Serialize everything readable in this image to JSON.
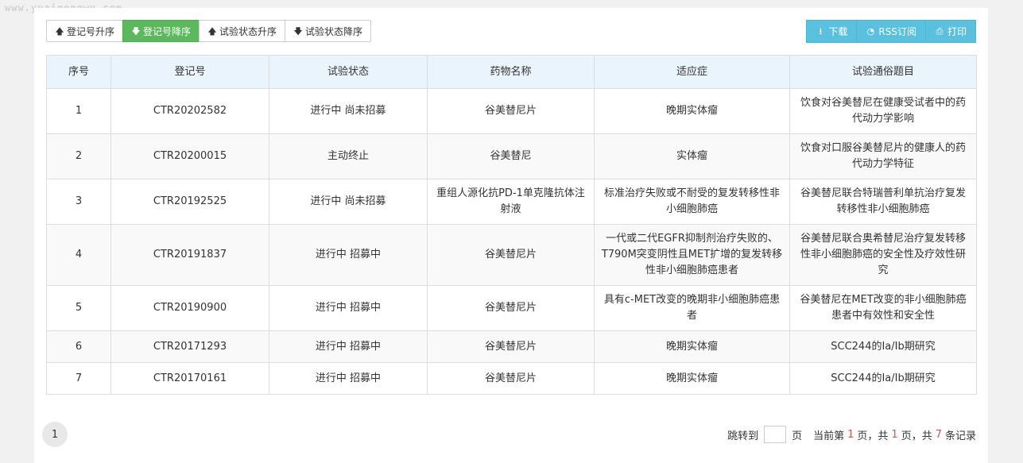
{
  "watermark": "www.yuaigongwu.com",
  "sort_buttons": [
    {
      "label": "登记号升序",
      "direction": "up",
      "active": false
    },
    {
      "label": "登记号降序",
      "direction": "down",
      "active": true
    },
    {
      "label": "试验状态升序",
      "direction": "up",
      "active": false
    },
    {
      "label": "试验状态降序",
      "direction": "down",
      "active": false
    }
  ],
  "action_buttons": [
    {
      "label": "下载",
      "icon": "download-icon"
    },
    {
      "label": "RSS订阅",
      "icon": "rss-icon"
    },
    {
      "label": "打印",
      "icon": "print-icon"
    }
  ],
  "table": {
    "columns": [
      "序号",
      "登记号",
      "试验状态",
      "药物名称",
      "适应症",
      "试验通俗题目"
    ],
    "rows": [
      [
        "1",
        "CTR20202582",
        "进行中 尚未招募",
        "谷美替尼片",
        "晚期实体瘤",
        "饮食对谷美替尼在健康受试者中的药代动力学影响"
      ],
      [
        "2",
        "CTR20200015",
        "主动终止",
        "谷美替尼",
        "实体瘤",
        "饮食对口服谷美替尼片的健康人的药代动力学特征"
      ],
      [
        "3",
        "CTR20192525",
        "进行中 尚未招募",
        "重组人源化抗PD-1单克隆抗体注射液",
        "标准治疗失败或不耐受的复发转移性非小细胞肺癌",
        "谷美替尼联合特瑞普利单抗治疗复发转移性非小细胞肺癌"
      ],
      [
        "4",
        "CTR20191837",
        "进行中 招募中",
        "谷美替尼片",
        "一代或二代EGFR抑制剂治疗失败的、T790M突变阴性且MET扩增的复发转移性非小细胞肺癌患者",
        "谷美替尼联合奥希替尼治疗复发转移性非小细胞肺癌的安全性及疗效性研究"
      ],
      [
        "5",
        "CTR20190900",
        "进行中 招募中",
        "谷美替尼片",
        "具有c-MET改变的晚期非小细胞肺癌患者",
        "谷美替尼在MET改变的非小细胞肺癌患者中有效性和安全性"
      ],
      [
        "6",
        "CTR20171293",
        "进行中 招募中",
        "谷美替尼片",
        "晚期实体瘤",
        "SCC244的Ia/Ib期研究"
      ],
      [
        "7",
        "CTR20170161",
        "进行中 招募中",
        "谷美替尼片",
        "晚期实体瘤",
        "SCC244的Ia/Ib期研究"
      ]
    ]
  },
  "pagination": {
    "current_page": "1",
    "jump_label": "跳转到",
    "jump_value": "",
    "page_unit": "页",
    "info_prefix": "当前第",
    "info_current": "1",
    "info_mid1": "页，共",
    "info_total_pages": "1",
    "info_mid2": "页，共",
    "info_total_records": "7",
    "info_suffix": "条记录"
  },
  "colors": {
    "active_sort": "#5cb85c",
    "action_button": "#5bc0de",
    "header_bg": "#eaf4fc",
    "highlight_number": "#d9534f"
  }
}
